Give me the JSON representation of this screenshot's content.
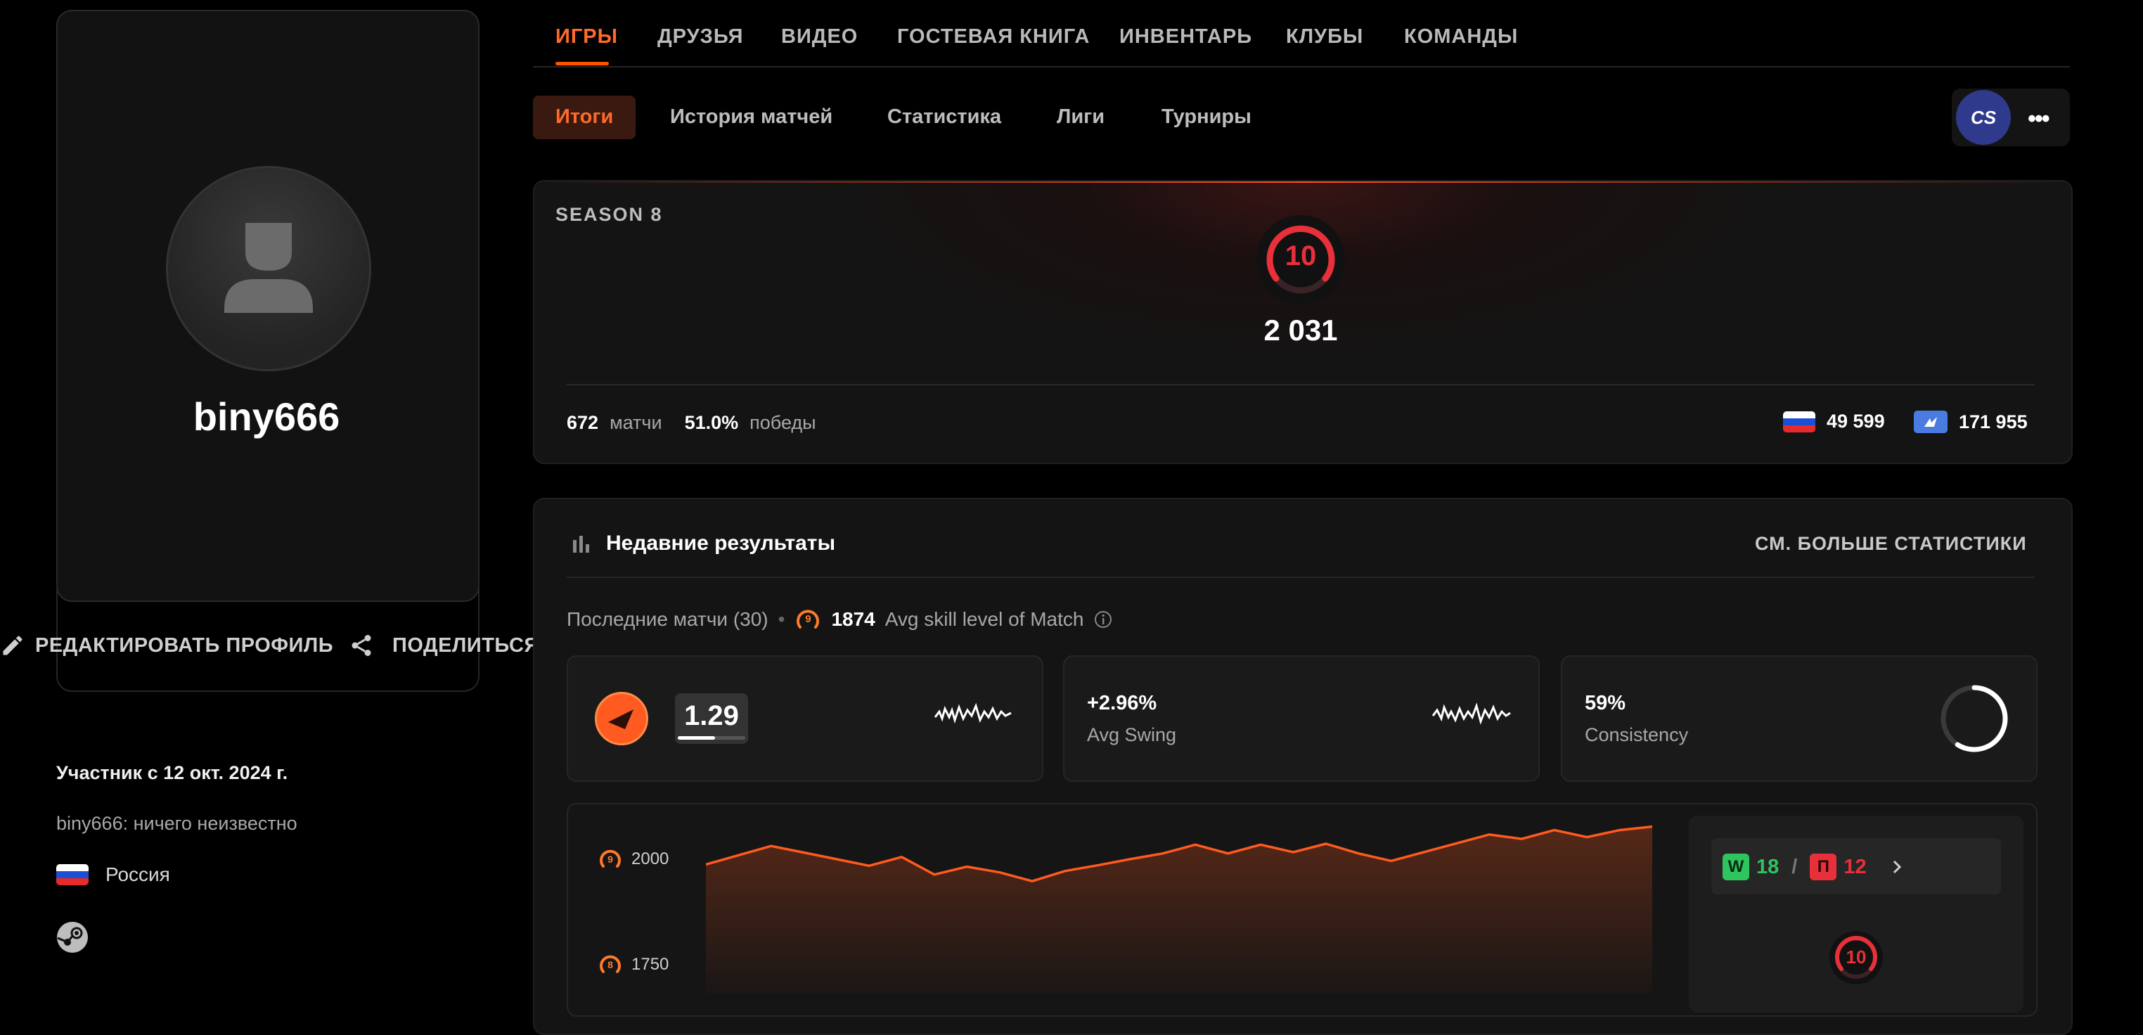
{
  "profile": {
    "username": "biny666",
    "edit_label": "РЕДАКТИРОВАТЬ ПРОФИЛЬ",
    "share_label": "ПОДЕЛИТЬСЯ",
    "member_since": "Участник с 12 окт. 2024 г.",
    "bio": "biny666: ничего неизвестно",
    "country": "Россия"
  },
  "nav": {
    "tabs": [
      "ИГРЫ",
      "ДРУЗЬЯ",
      "ВИДЕО",
      "ГОСТЕВАЯ КНИГА",
      "ИНВЕНТАРЬ",
      "КЛУБЫ",
      "КОМАНДЫ"
    ],
    "active_tab": "ИГРЫ",
    "subtabs": [
      "Итоги",
      "История матчей",
      "Статистика",
      "Лиги",
      "Турниры"
    ],
    "active_subtab": "Итоги",
    "game_badge": "CS",
    "more_icon": "dots-icon"
  },
  "season": {
    "label": "SEASON 8",
    "level": "10",
    "elo": "2 031",
    "matches_value": "672",
    "matches_label": "матчи",
    "winrate_value": "51.0%",
    "winrate_label": "победы",
    "country_rank": "49 599",
    "region_rank": "171 955"
  },
  "recent": {
    "title": "Недавние результаты",
    "more_link": "СМ. БОЛЬШЕ СТАТИСТИКИ",
    "last_matches": "Последние матчи (30)",
    "avg_level": "9",
    "avg_skill_value": "1874",
    "avg_skill_label": "Avg skill level of Match",
    "rating_value": "1.29",
    "rating_progress": 0.55,
    "swing_value": "+2.96%",
    "swing_label": "Avg Swing",
    "consistency_value": "59%",
    "consistency_label": "Consistency",
    "consistency_fraction": 0.59
  },
  "chart_data": {
    "type": "area",
    "y_ticks": [
      {
        "value": "2000",
        "level": "9"
      },
      {
        "value": "1750",
        "level": "8"
      }
    ],
    "ylim": [
      1650,
      2040
    ],
    "values": [
      1945,
      1966,
      1987,
      1972,
      1957,
      1942,
      1962,
      1922,
      1940,
      1927,
      1907,
      1930,
      1943,
      1957,
      1970,
      1990,
      1970,
      1990,
      1973,
      1992,
      1970,
      1953,
      1973,
      1993,
      2013,
      2003,
      2023,
      2007,
      2023,
      2031
    ]
  },
  "record": {
    "wins_letter": "W",
    "wins": "18",
    "separator": "/",
    "losses_letter": "П",
    "losses": "12",
    "level": "10"
  },
  "colors": {
    "accent": "#ff5500",
    "level_red": "#e8303a",
    "win_green": "#2ec55f",
    "loss_red": "#e8303a",
    "background": "#000000"
  }
}
